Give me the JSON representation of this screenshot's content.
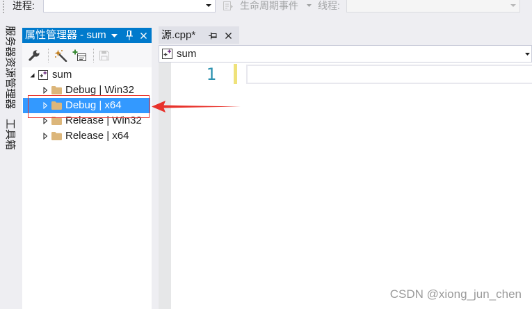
{
  "toolbar": {
    "process_label": "进程:",
    "process_value": "",
    "lifecycle_label": "生命周期事件",
    "lifecycle_icon": "lifecycle-events-icon",
    "thread_label": "线程:",
    "thread_value": ""
  },
  "side_tabs": [
    {
      "label": "服务器资源管理器"
    },
    {
      "label": "工具箱"
    }
  ],
  "property_manager": {
    "title": "属性管理器 - sum",
    "title_icons": [
      "dropdown-icon",
      "pin-icon",
      "close-icon"
    ],
    "toolbar_icons": [
      "wrench-icon",
      "magic-wand-icon",
      "add-property-sheet-icon",
      "save-icon"
    ],
    "tree": {
      "root": {
        "label": "sum",
        "icon": "vcxproj-icon",
        "expanded": true
      },
      "children": [
        {
          "label": "Debug | Win32",
          "icon": "folder-icon",
          "selected": false
        },
        {
          "label": "Debug | x64",
          "icon": "folder-icon",
          "selected": true
        },
        {
          "label": "Release | Win32",
          "icon": "folder-icon",
          "selected": false
        },
        {
          "label": "Release | x64",
          "icon": "folder-icon",
          "selected": false
        }
      ]
    }
  },
  "editor": {
    "tab": {
      "label": "源.cpp*",
      "icons": [
        "pin-icon",
        "close-icon"
      ]
    },
    "navigation": {
      "scope": "sum",
      "icon": "project-scope-icon"
    },
    "lines": [
      {
        "number": "1",
        "text": ""
      }
    ]
  },
  "watermark": "CSDN @xiong_jun_chen",
  "colors": {
    "title_bar": "#007acc",
    "selection": "#3399ff",
    "annotation": "#e8322b",
    "line_number": "#2b91af",
    "unsaved_change_marker": "#efe27a",
    "folder": "#dcb67a"
  }
}
